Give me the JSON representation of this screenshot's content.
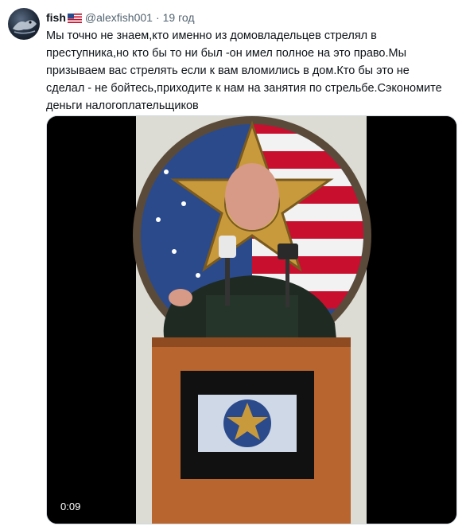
{
  "tweet": {
    "author_name": "fish",
    "flag_icon": "us-flag-icon",
    "handle": "@alexfish001",
    "separator": "·",
    "timestamp": "19 год",
    "text_lines": [
      "Мы точно не знаем,кто именно из домовладельцев стрелял в",
      "преступника,но кто бы то ни был -он имел полное на это право.Мы",
      "призываем вас стрелять если к вам вломились в дом.Кто бы это не",
      "сделал - не бойтесь,приходите к нам на занятия по стрельбе.Сэкономите",
      "деньги налогоплательщиков"
    ]
  },
  "media": {
    "type": "video",
    "elapsed": "0:09",
    "colors": {
      "background": "#000000",
      "uniform": "#1f2b22",
      "podium": "#b8652f",
      "wall": "#dcdcd4"
    }
  }
}
